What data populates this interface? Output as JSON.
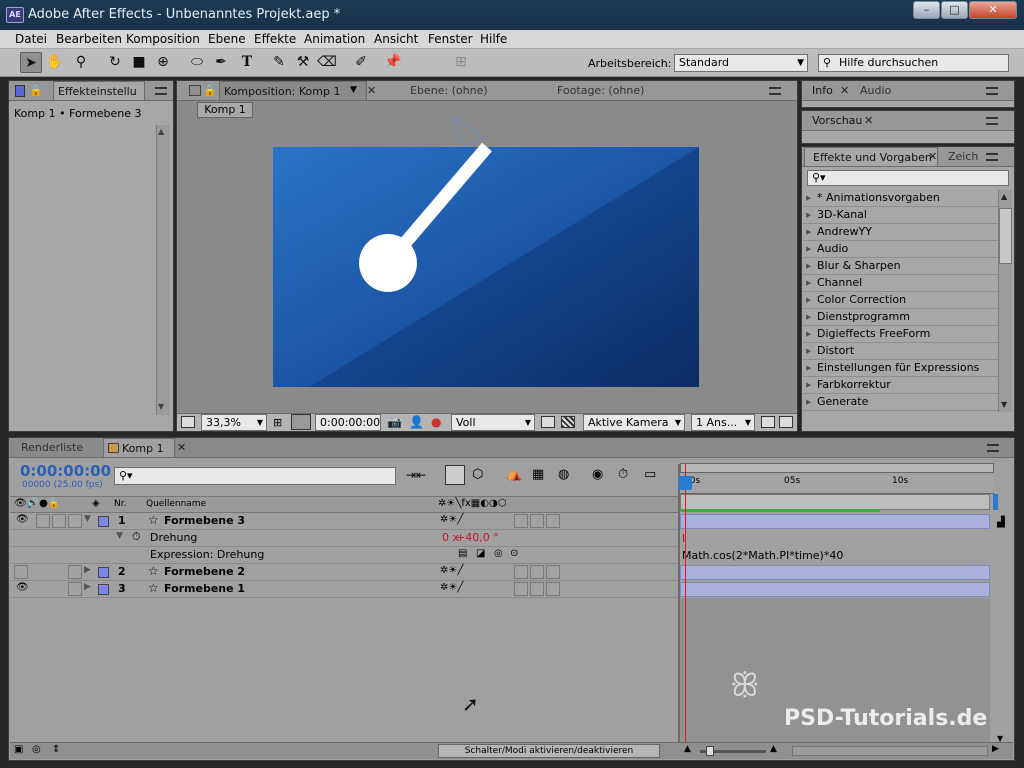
{
  "window": {
    "title": "Adobe After Effects - Unbenanntes Projekt.aep *",
    "app_icon": "AE",
    "controls": [
      "–",
      "□",
      "✕"
    ]
  },
  "menu": [
    "Datei",
    "Bearbeiten",
    "Komposition",
    "Ebene",
    "Effekte",
    "Animation",
    "Ansicht",
    "Fenster",
    "Hilfe"
  ],
  "toolbar": {
    "workspace_label": "Arbeitsbereich:",
    "workspace_value": "Standard",
    "help_placeholder": "Hilfe durchsuchen"
  },
  "effect_controls": {
    "tab": "Effekteinstellu",
    "breadcrumb": "Komp 1 • Formebene 3"
  },
  "viewer": {
    "tabs": [
      "Komposition: Komp 1",
      "Ebene: (ohne)",
      "Footage: (ohne)"
    ],
    "comp_chip": "Komp 1",
    "zoom": "33,3%",
    "timecode": "0:00:00:00",
    "resolution": "Voll",
    "camera": "Aktive Kamera",
    "views": "1 Ans..."
  },
  "right_panels": {
    "info_tabs": [
      "Info",
      "Audio"
    ],
    "preview_tab": "Vorschau",
    "effects_tabs": [
      "Effekte und Vorgaben",
      "Zeich"
    ],
    "effects_list": [
      "* Animationsvorgaben",
      "3D-Kanal",
      "AndrewYY",
      "Audio",
      "Blur & Sharpen",
      "Channel",
      "Color Correction",
      "Dienstprogramm",
      "Digieffects FreeForm",
      "Distort",
      "Einstellungen für Expressions",
      "Farbkorrektur",
      "Generate"
    ]
  },
  "timeline": {
    "tabs": [
      "Renderliste",
      "Komp 1"
    ],
    "timecode": "0:00:00:00",
    "frames": "00000 (25.00 fps)",
    "col_nr": "Nr.",
    "col_source": "Quellenname",
    "ruler": [
      "00s",
      "05s",
      "10s"
    ],
    "layers": [
      {
        "nr": "1",
        "name": "Formebene 3"
      },
      {
        "nr": "2",
        "name": "Formebene 2"
      },
      {
        "nr": "3",
        "name": "Formebene 1"
      }
    ],
    "prop_name": "Drehung",
    "prop_value_turns": "0 x",
    "prop_value_deg": "+40,0 °",
    "expr_label": "Expression: Drehung",
    "expression": "Math.cos(2*Math.PI*time)*40",
    "toggle_label": "Schalter/Modi aktivieren/deaktivieren"
  },
  "watermark": "PSD-Tutorials.de",
  "colors": {
    "accent": "#1a62b4",
    "layer_label": "#7d86e6",
    "track": "#aab0dc",
    "timecode": "#2b5fb8",
    "expression_value": "#c8102e"
  }
}
